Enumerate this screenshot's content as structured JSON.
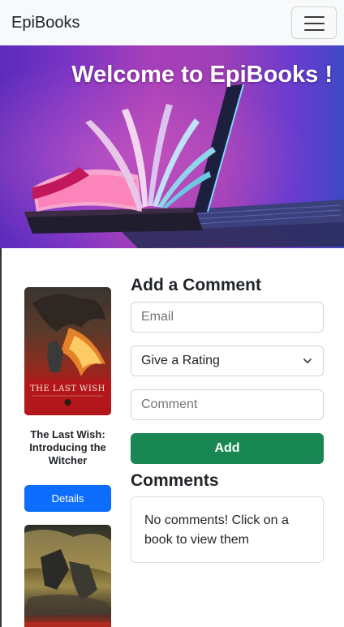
{
  "navbar": {
    "brand": "EpiBooks",
    "toggler_icon": "hamburger-menu-icon"
  },
  "hero": {
    "title": "Welcome to EpiBooks !"
  },
  "books": [
    {
      "title": "The Last Wish: Introducing the Witcher",
      "details_label": "Details",
      "cover_text": "THE LAST WISH"
    },
    {
      "title": "",
      "details_label": ""
    }
  ],
  "comment_form": {
    "heading": "Add a Comment",
    "email_placeholder": "Email",
    "rating_selected": "Give a Rating",
    "comment_placeholder": "Comment",
    "submit_label": "Add"
  },
  "comments": {
    "heading": "Comments",
    "empty_message": "No comments! Click on a book to view them"
  },
  "colors": {
    "navbar_bg": "#f8f9fa",
    "primary": "#0d6efd",
    "success": "#198754"
  }
}
